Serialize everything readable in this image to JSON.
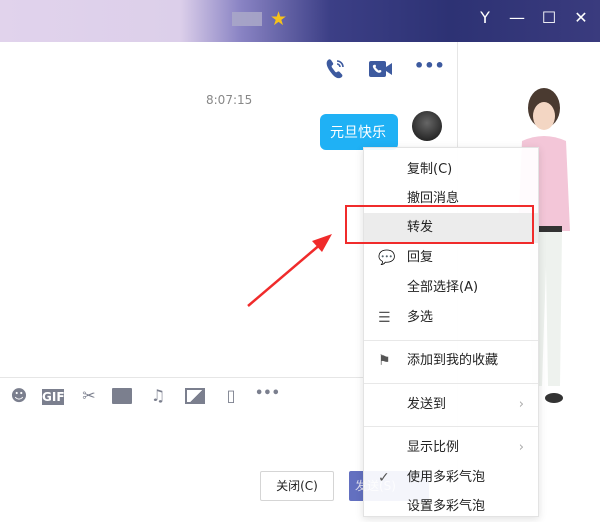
{
  "window": {
    "controls": [
      "Y",
      "—",
      "☐",
      "✕"
    ]
  },
  "chat": {
    "time": "8:07:15",
    "message": "元旦快乐"
  },
  "toolbar": {
    "icons": [
      "emoji-icon",
      "gif-icon",
      "scissors-icon",
      "folder-icon",
      "music-icon",
      "image-icon",
      "shake-icon",
      "more-icon"
    ],
    "gif": "GIF",
    "more": "•••"
  },
  "buttons": {
    "close": "关闭(C)",
    "send": "发送(S)"
  },
  "menu": {
    "items": [
      "复制(C)",
      "撤回消息",
      "转发",
      "回复",
      "全部选择(A)",
      "多选",
      "添加到我的收藏",
      "发送到",
      "显示比例",
      "使用多彩气泡",
      "设置多彩气泡"
    ]
  },
  "colors": {
    "highlight": "#f02b2b",
    "bubble": "#1fb1f5",
    "icon": "#3d5a9f"
  }
}
